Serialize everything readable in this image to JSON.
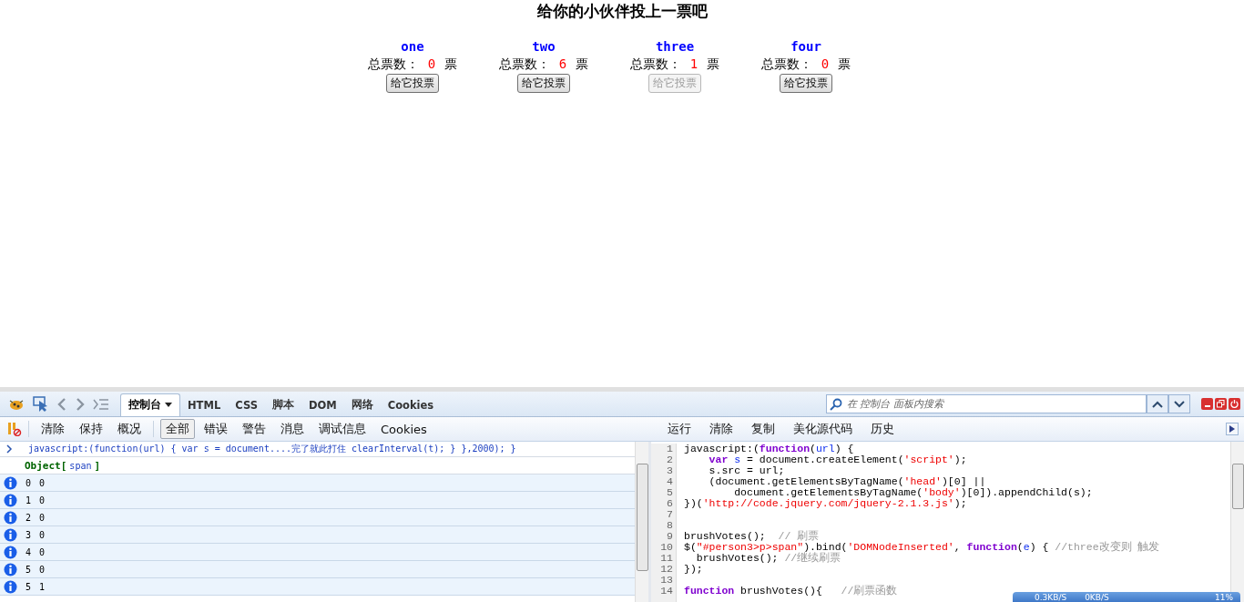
{
  "page": {
    "title": "给你的小伙伴投上一票吧",
    "candidates": [
      {
        "name": "one",
        "label": "总票数：",
        "votes": "0",
        "unit": "票",
        "button": "给它投票",
        "disabled": false
      },
      {
        "name": "two",
        "label": "总票数：",
        "votes": "6",
        "unit": "票",
        "button": "给它投票",
        "disabled": false
      },
      {
        "name": "three",
        "label": "总票数：",
        "votes": "1",
        "unit": "票",
        "button": "给它投票",
        "disabled": true
      },
      {
        "name": "four",
        "label": "总票数：",
        "votes": "0",
        "unit": "票",
        "button": "给它投票",
        "disabled": false
      }
    ]
  },
  "devtools": {
    "tabs": [
      {
        "label": "控制台",
        "selected": true,
        "dropdown": true
      },
      {
        "label": "HTML",
        "selected": false
      },
      {
        "label": "CSS",
        "selected": false
      },
      {
        "label": "脚本",
        "selected": false
      },
      {
        "label": "DOM",
        "selected": false
      },
      {
        "label": "网络",
        "selected": false
      },
      {
        "label": "Cookies",
        "selected": false
      }
    ],
    "search": {
      "placeholder": "在 控制台 面板内搜索"
    },
    "console_toolbar": [
      {
        "label": "清除",
        "selected": false
      },
      {
        "label": "保持",
        "selected": false
      },
      {
        "label": "概况",
        "selected": false
      },
      {
        "label": "全部",
        "selected": true
      },
      {
        "label": "错误",
        "selected": false
      },
      {
        "label": "警告",
        "selected": false
      },
      {
        "label": "消息",
        "selected": false
      },
      {
        "label": "调试信息",
        "selected": false
      },
      {
        "label": "Cookies",
        "selected": false
      }
    ],
    "editor_toolbar": [
      "运行",
      "清除",
      "复制",
      "美化源代码",
      "历史"
    ],
    "console": {
      "command": "javascript:(function(url) {     var s = document....完了就此打住     clearInterval(t);   }   },2000); }",
      "object": {
        "type": "Object[",
        "tag": "span",
        "close": "]"
      },
      "logs": [
        {
          "index": "0",
          "value": "0"
        },
        {
          "index": "1",
          "value": "0"
        },
        {
          "index": "2",
          "value": "0"
        },
        {
          "index": "3",
          "value": "0"
        },
        {
          "index": "4",
          "value": "0"
        },
        {
          "index": "5",
          "value": "0"
        },
        {
          "index": "5",
          "value": "1"
        }
      ]
    },
    "editor": {
      "lines": [
        {
          "number": "1",
          "segments": [
            {
              "kind": "plain",
              "text": "javascript:("
            },
            {
              "kind": "keyword",
              "text": "function"
            },
            {
              "kind": "plain",
              "text": "("
            },
            {
              "kind": "var",
              "text": "url"
            },
            {
              "kind": "plain",
              "text": ") {"
            }
          ]
        },
        {
          "number": "2",
          "segments": [
            {
              "kind": "keyword",
              "text": "    var"
            },
            {
              "kind": "var",
              "text": " s"
            },
            {
              "kind": "plain",
              "text": " = document.createElement("
            },
            {
              "kind": "string",
              "text": "'script'"
            },
            {
              "kind": "plain",
              "text": ");"
            }
          ]
        },
        {
          "number": "3",
          "segments": [
            {
              "kind": "plain",
              "text": "    s.src = url;"
            }
          ]
        },
        {
          "number": "4",
          "segments": [
            {
              "kind": "plain",
              "text": "    (document.getElementsByTagName("
            },
            {
              "kind": "string",
              "text": "'head'"
            },
            {
              "kind": "plain",
              "text": ")[0] ||"
            }
          ]
        },
        {
          "number": "5",
          "segments": [
            {
              "kind": "plain",
              "text": "        document.getElementsByTagName("
            },
            {
              "kind": "string",
              "text": "'body'"
            },
            {
              "kind": "plain",
              "text": ")[0]).appendChild(s);"
            }
          ]
        },
        {
          "number": "6",
          "segments": [
            {
              "kind": "plain",
              "text": "})("
            },
            {
              "kind": "string",
              "text": "'http://code.jquery.com/jquery-2.1.3.js'"
            },
            {
              "kind": "plain",
              "text": ");"
            }
          ]
        },
        {
          "number": "7"
        },
        {
          "number": "8"
        },
        {
          "number": "9",
          "segments": [
            {
              "kind": "plain",
              "text": "brushVotes();  "
            },
            {
              "kind": "comment",
              "text": "// 刷票"
            }
          ]
        },
        {
          "number": "10",
          "segments": [
            {
              "kind": "plain",
              "text": "$("
            },
            {
              "kind": "string",
              "text": "\"#person3>p>span\""
            },
            {
              "kind": "plain",
              "text": ").bind("
            },
            {
              "kind": "string",
              "text": "'DOMNodeInserted'"
            },
            {
              "kind": "plain",
              "text": ", "
            },
            {
              "kind": "keyword",
              "text": "function"
            },
            {
              "kind": "plain",
              "text": "("
            },
            {
              "kind": "var",
              "text": "e"
            },
            {
              "kind": "plain",
              "text": ") { "
            },
            {
              "kind": "comment",
              "text": "//three改变则 触发"
            }
          ]
        },
        {
          "number": "11",
          "segments": [
            {
              "kind": "plain",
              "text": "  brushVotes(); "
            },
            {
              "kind": "comment",
              "text": "//继续刷票"
            }
          ]
        },
        {
          "number": "12",
          "segments": [
            {
              "kind": "plain",
              "text": "});"
            }
          ]
        },
        {
          "number": "13"
        },
        {
          "number": "14",
          "segments": [
            {
              "kind": "keyword",
              "text": "function"
            },
            {
              "kind": "plain",
              "text": " brushVotes(){   "
            },
            {
              "kind": "comment",
              "text": "//刷票函数"
            }
          ]
        }
      ]
    },
    "net_meter": {
      "down": "0.3KB/S",
      "up": "0KB/S",
      "cpu": "11%"
    }
  }
}
